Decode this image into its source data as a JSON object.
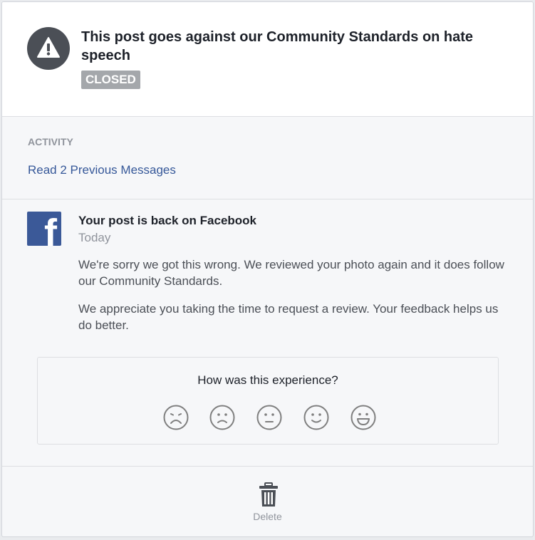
{
  "notice": {
    "icon": "warning-icon",
    "title": "This post goes against our Community Standards on hate speech",
    "status_badge": "CLOSED"
  },
  "activity": {
    "label": "ACTIVITY",
    "read_link": "Read 2 Previous Messages"
  },
  "message": {
    "sender_icon": "facebook-logo-icon",
    "title": "Your post is back on Facebook",
    "date": "Today",
    "paragraphs": [
      "We're sorry we got this wrong. We reviewed your photo again and it does follow our Community Standards.",
      "We appreciate you taking the time to request a review. Your feedback helps us do better."
    ]
  },
  "feedback": {
    "question": "How was this experience?",
    "options": [
      "very-dissatisfied-face-icon",
      "dissatisfied-face-icon",
      "neutral-face-icon",
      "satisfied-face-icon",
      "very-satisfied-face-icon"
    ]
  },
  "footer": {
    "delete_icon": "trash-icon",
    "delete_label": "Delete"
  },
  "colors": {
    "link": "#365899",
    "badge": "#a4a7ab",
    "facebook_blue": "#3b5998",
    "warning_circle": "#4b4f56"
  }
}
